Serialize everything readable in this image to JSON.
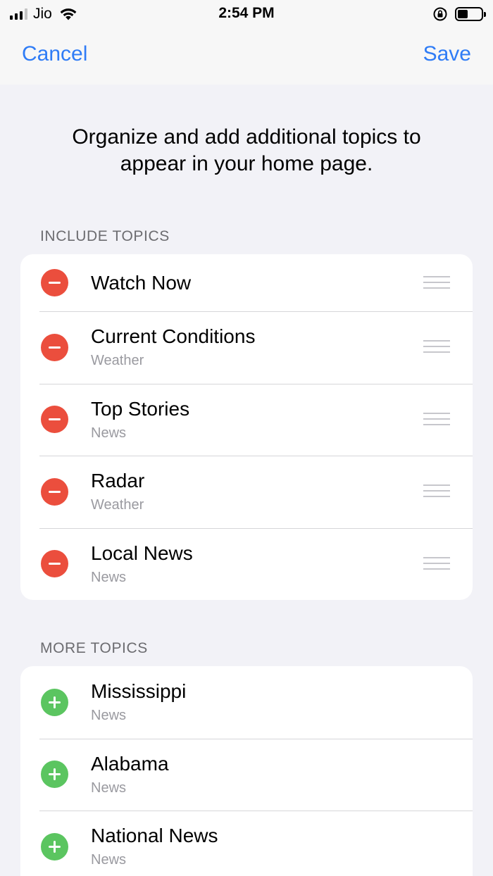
{
  "status_bar": {
    "carrier": "Jio",
    "time": "2:54 PM",
    "icons": [
      "signal-icon",
      "wifi-icon",
      "orientation-lock-icon",
      "battery-icon"
    ],
    "battery_level": 0.45
  },
  "nav": {
    "cancel_label": "Cancel",
    "save_label": "Save"
  },
  "intro": {
    "line1": "Organize and add additional topics to",
    "line2": "appear in your home page."
  },
  "include": {
    "header": "INCLUDE TOPICS",
    "items": [
      {
        "title": "Watch Now",
        "subtitle": ""
      },
      {
        "title": "Current Conditions",
        "subtitle": "Weather"
      },
      {
        "title": "Top Stories",
        "subtitle": "News"
      },
      {
        "title": "Radar",
        "subtitle": "Weather"
      },
      {
        "title": "Local News",
        "subtitle": "News"
      }
    ]
  },
  "more": {
    "header": "MORE TOPICS",
    "items": [
      {
        "title": "Mississippi",
        "subtitle": "News"
      },
      {
        "title": "Alabama",
        "subtitle": "News"
      },
      {
        "title": "National News",
        "subtitle": "News"
      }
    ]
  },
  "colors": {
    "accent": "#2f7cf6",
    "remove": "#eb4e3d",
    "add": "#5bc560",
    "background": "#f2f2f7"
  }
}
